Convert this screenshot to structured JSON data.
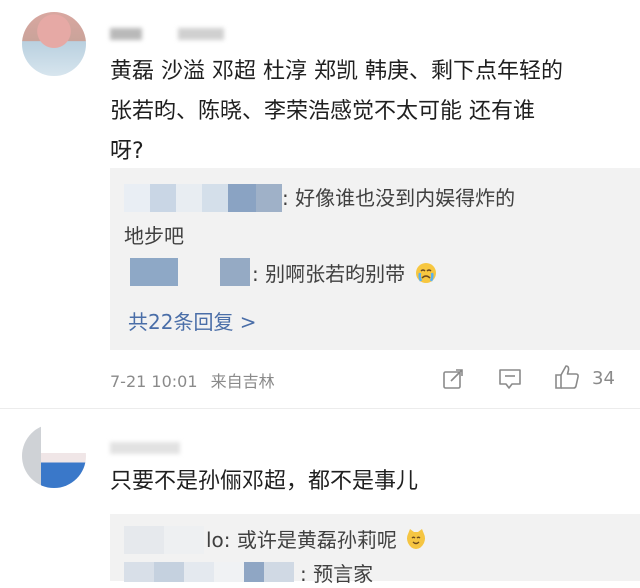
{
  "comment1": {
    "text_line1": "黄磊 沙溢 邓超 杜淳 郑凯 韩庚、剩下点年轻的",
    "text_line2": "张若昀、陈晓、李荣浩感觉不太可能  还有谁",
    "text_line3": "呀?",
    "replies": [
      {
        "text_line1": ": 好像谁也没到内娱得炸的",
        "text_line2": "地步吧"
      },
      {
        "text": ": 别啊张若昀别带"
      }
    ],
    "more_replies": "共22条回复 >",
    "timestamp": "7-21 10:01",
    "location": "来自吉林",
    "like_count": "34"
  },
  "comment2": {
    "text": "只要不是孙俪邓超，都不是事儿",
    "replies": [
      {
        "text": "lo: 或许是黄磊孙莉呢"
      },
      {
        "text": " : 预言家"
      }
    ]
  },
  "colors": {
    "reply_bg": "#f2f2f2",
    "link": "#4a6ea8",
    "meta": "#8a8a8a"
  },
  "icons": [
    "share-icon",
    "comment-icon",
    "like-icon",
    "crying-emoji-icon",
    "cat-emoji-icon"
  ]
}
